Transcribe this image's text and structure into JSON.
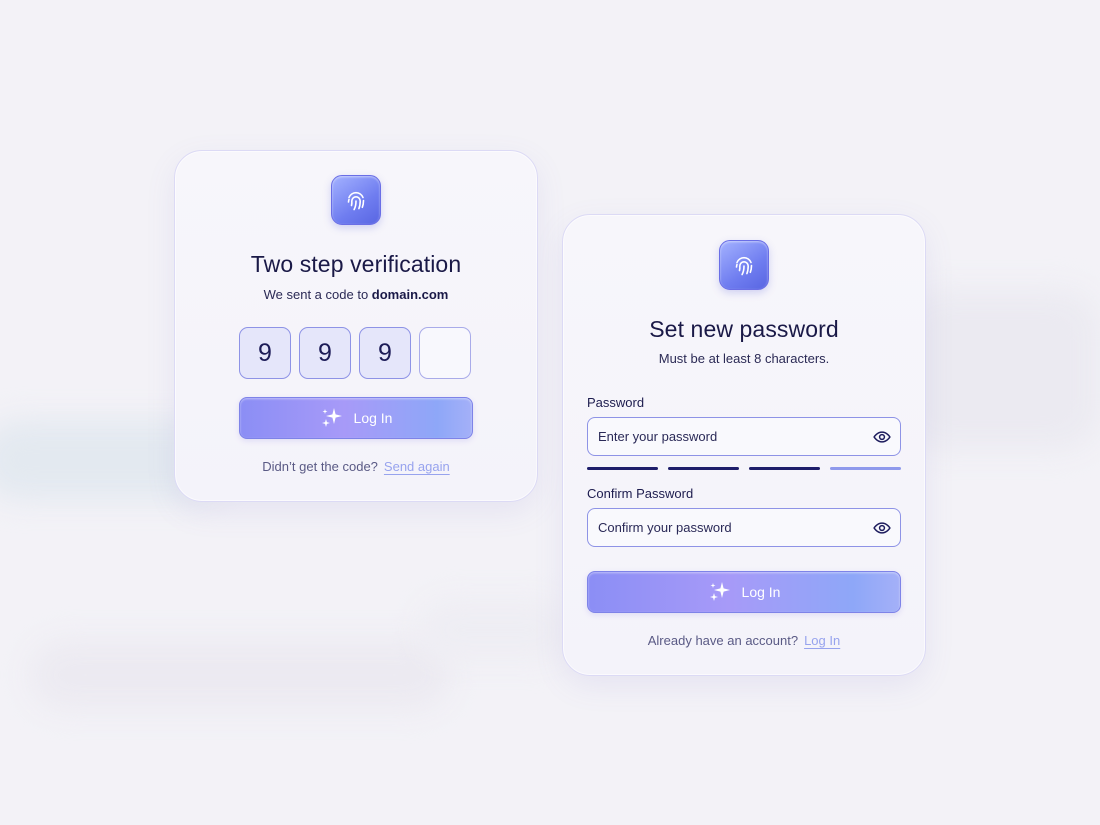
{
  "verification_card": {
    "title": "Two step verification",
    "subtitle_prefix": "We sent a code to",
    "subtitle_domain": "domain.com",
    "code_digits": [
      "9",
      "9",
      "9",
      ""
    ],
    "button_label": "Log In",
    "footer_text": "Didn’t get the code?",
    "footer_link": "Send again",
    "icon": "fingerprint-icon"
  },
  "password_card": {
    "title": "Set new password",
    "subtitle": "Must be at least 8 characters.",
    "password_label": "Password",
    "password_placeholder": "Enter your password",
    "confirm_label": "Confirm Password",
    "confirm_placeholder": "Confirm your password",
    "strength_filled_segments": 3,
    "strength_total_segments": 4,
    "button_label": "Log In",
    "footer_text": "Already have an account?",
    "footer_link": "Log In",
    "icon": "fingerprint-icon"
  },
  "colors": {
    "background": "#f3f2f7",
    "accent": "#7e83e8",
    "text_dark": "#1a1947",
    "link": "#97a3ee",
    "strength_strong": "#1e1d6a",
    "strength_weak": "#8f99ec"
  }
}
